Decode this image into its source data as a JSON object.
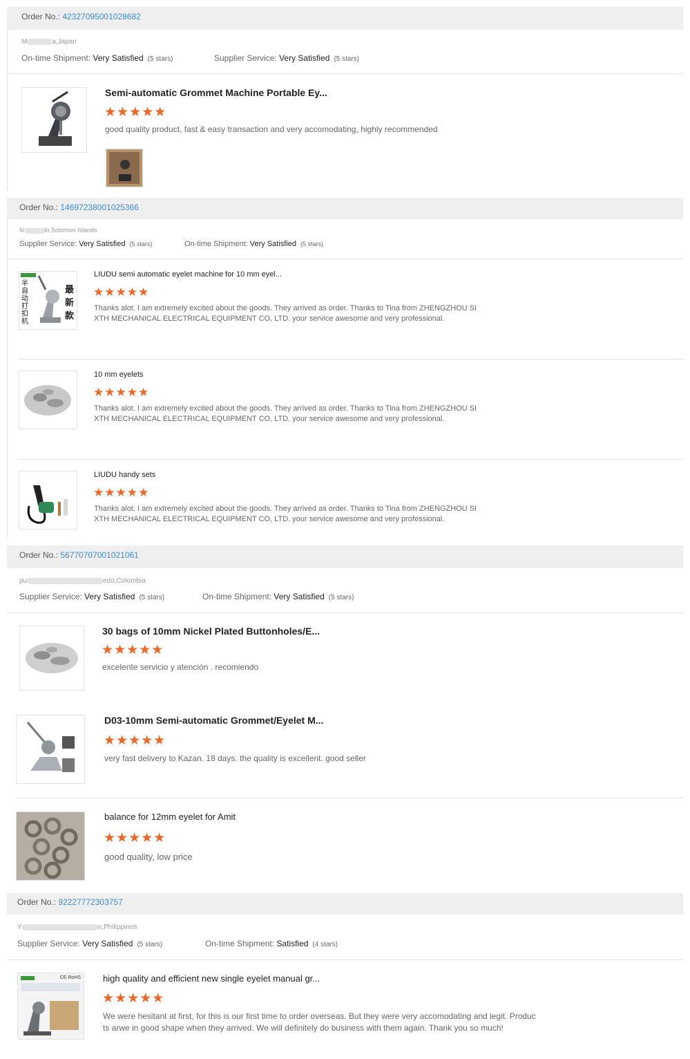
{
  "colors": {
    "link": "#3a8bd6",
    "star": "#f26522",
    "bar": "#efefef"
  },
  "orders": [
    {
      "label": "Order No.:",
      "number": "42327095001028682",
      "buyer_suffix": "a,Japan",
      "buyer_prefix": "M",
      "services": [
        {
          "label": "On-time Shipment:",
          "value": "Very Satisfied",
          "stars": "(5 stars)"
        },
        {
          "label": "Supplier Service:",
          "value": "Very Satisfied",
          "stars": "(5 stars)"
        }
      ],
      "items": [
        {
          "title": "Semi-automatic Grommet Machine Portable Ey...",
          "stars": "★★★★★",
          "review": "good quality product, fast & easy transaction and very accomodating, highly recommended"
        }
      ]
    },
    {
      "label": "Order No.:",
      "number": "14697238001025366",
      "buyer_suffix": "lo,Solomon Islands",
      "buyer_prefix": "N",
      "services": [
        {
          "label": "Supplier Service:",
          "value": "Very Satisfied",
          "stars": "(5 stars)"
        },
        {
          "label": "On-time Shipment:",
          "value": "Very Satisfied",
          "stars": "(5 stars)"
        }
      ],
      "items": [
        {
          "title": "LIUDU semi automatic eyelet machine for 10 mm eyel...",
          "stars": "★★★★★",
          "review": "Thanks alot. I am extremely excited about the goods. They arrived as order. Thanks to Tina from ZHENGZHOU SIXTH MECHANICAL ELECTRICAL EQUIPMENT CO, LTD. your service awesome and very professional."
        },
        {
          "title": "10 mm eyelets",
          "stars": "★★★★★",
          "review": "Thanks alot. I am extremely excited about the goods. They arrived as order. Thanks to Tina from ZHENGZHOU SIXTH MECHANICAL ELECTRICAL EQUIPMENT CO, LTD. your service awesome and very professional."
        },
        {
          "title": "LIUDU handy sets",
          "stars": "★★★★★",
          "review": "Thanks alot. I am extremely excited about the goods. They arrived as order. Thanks to Tina from ZHENGZHOU SIXTH MECHANICAL ELECTRICAL EQUIPMENT CO, LTD. your service awesome and very professional."
        }
      ],
      "thumb1_text": [
        "半",
        "自",
        "动",
        "打",
        "扣",
        "机"
      ],
      "thumb1_text_right": [
        "最",
        "新",
        "款"
      ]
    },
    {
      "label": "Order No.:",
      "number": "56770707001021061",
      "buyer_suffix": "edo,Colombia",
      "buyer_prefix": "pu",
      "services": [
        {
          "label": "Supplier Service:",
          "value": "Very Satisfied",
          "stars": "(5 stars)"
        },
        {
          "label": "On-time Shipment:",
          "value": "Very Satisfied",
          "stars": "(5 stars)"
        }
      ],
      "items": [
        {
          "title": "30 bags of 10mm Nickel Plated Buttonholes/E...",
          "stars": "★★★★★",
          "review": "excelente servicio y atención . recomiendo"
        },
        {
          "title": "D03-10mm Semi-automatic Grommet/Eyelet M...",
          "stars": "★★★★★",
          "review": "very fast delivery to Kazan. 18 days. the quality is excellent. good seller"
        },
        {
          "title": "balance for 12mm eyelet for Amit",
          "stars": "★★★★★",
          "review": "good quality, low price"
        }
      ]
    },
    {
      "label": "Order No.:",
      "number": "92227772303757",
      "buyer_suffix": "n,Philippines",
      "buyer_prefix": "Y",
      "services": [
        {
          "label": "Supplier Service:",
          "value": "Very Satisfied",
          "stars": "(5 stars)"
        },
        {
          "label": "On-time Shipment:",
          "value": "Satisfied",
          "stars": "(4 stars)"
        }
      ],
      "items": [
        {
          "title": "high quality and efficient new single eyelet manual gr...",
          "stars": "★★★★★",
          "review": "We were hesitant at first, for this is our first time to order overseas. But they were very accomodating and legit. Products arwe in good shape when they arrived. We will definitely do business with them again. Thank you so much!"
        }
      ],
      "thumb_brand": "CE RoHS"
    }
  ]
}
